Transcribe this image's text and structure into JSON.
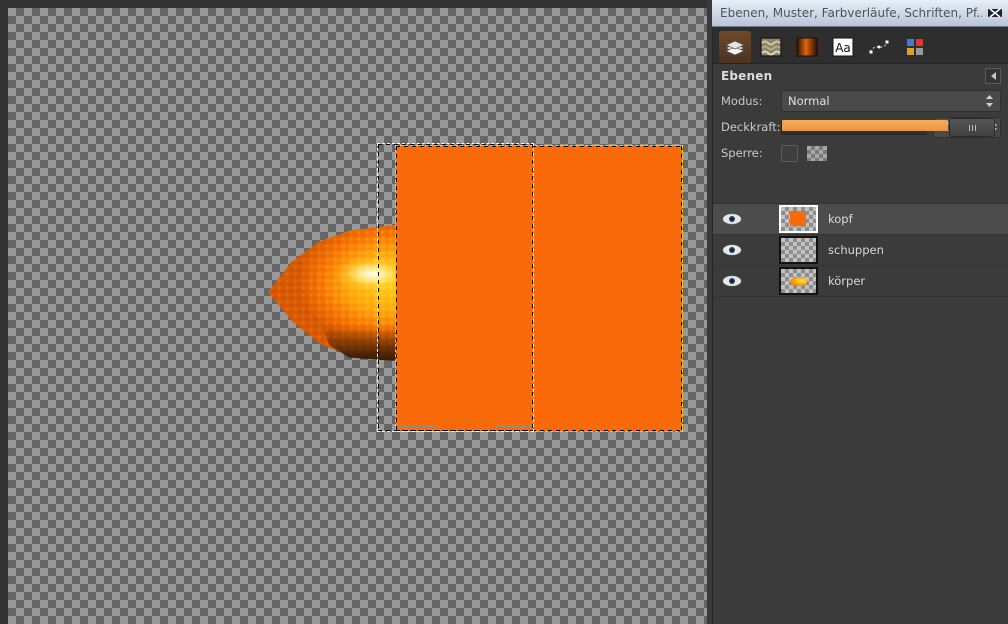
{
  "window": {
    "title": "Ebenen, Muster, Farbverläufe, Schriften, Pf...",
    "close_icon": "close-icon"
  },
  "tabs": [
    {
      "name": "layers-tab",
      "icon": "layers-icon",
      "active": true
    },
    {
      "name": "patterns-tab",
      "icon": "pattern-icon",
      "active": false
    },
    {
      "name": "gradients-tab",
      "icon": "gradient-icon",
      "active": false
    },
    {
      "name": "fonts-tab",
      "icon": "text-aa-icon",
      "active": false,
      "label": "Aa"
    },
    {
      "name": "paths-tab",
      "icon": "paths-icon",
      "active": false
    },
    {
      "name": "palettes-tab",
      "icon": "palette-icon",
      "active": false
    }
  ],
  "panel": {
    "title": "Ebenen",
    "menu_button_icon": "menu-arrow-icon"
  },
  "controls": {
    "mode_label": "Modus:",
    "mode_value": "Normal",
    "opacity_label": "Deckkraft:",
    "opacity_value": "100,0",
    "opacity_percent": 100,
    "lock_label": "Sperre:",
    "lock_alpha_icon": "checkerboard-icon"
  },
  "layers": [
    {
      "name": "kopf",
      "visible": true,
      "selected": true,
      "thumb": "orange-square"
    },
    {
      "name": "schuppen",
      "visible": true,
      "selected": false,
      "thumb": "faint-scales"
    },
    {
      "name": "körper",
      "visible": true,
      "selected": false,
      "thumb": "orange-fish"
    }
  ],
  "canvas": {
    "background": "transparent-checkerboard",
    "layer_fill_color": "#fa6a0a",
    "layer_boundary_color": "#ffd000",
    "selection_color": "#ffffff",
    "content": "goldfish-head-with-orange-rectangle-layer"
  },
  "colors": {
    "orange_accent": "#fa6a0a",
    "slider_orange": "#ec9440",
    "dock_bg": "#3b3b3b",
    "titlebar": "#cdd8e6"
  }
}
